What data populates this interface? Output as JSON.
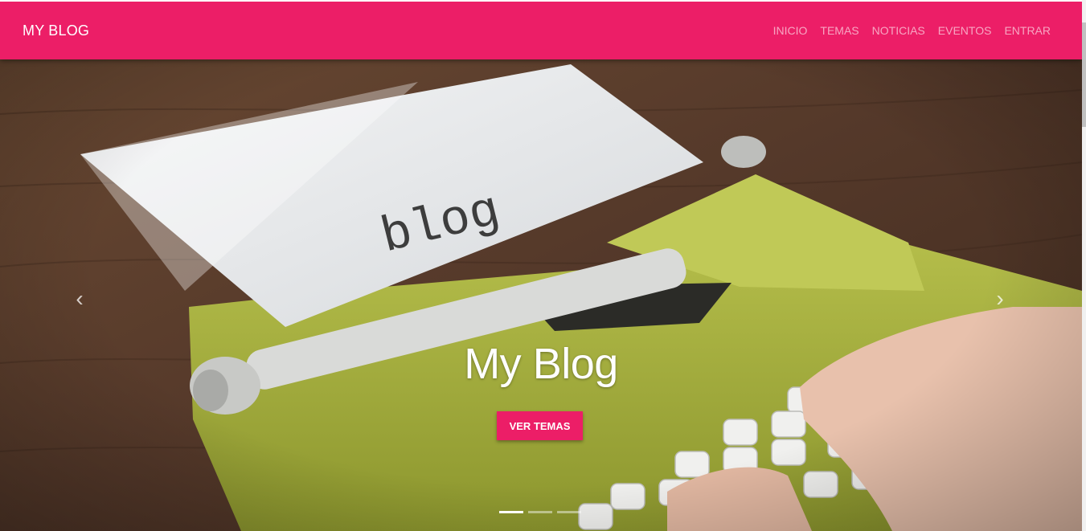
{
  "navbar": {
    "brand": "MY BLOG",
    "items": [
      {
        "label": "INICIO"
      },
      {
        "label": "TEMAS"
      },
      {
        "label": "NOTICIAS"
      },
      {
        "label": "EVENTOS"
      },
      {
        "label": "ENTRAR"
      }
    ],
    "background_color": "#ec1e67"
  },
  "carousel": {
    "image_text": "blog",
    "caption_title": "My Blog",
    "cta_label": "VER TEMAS",
    "prev_icon": "chevron-left-icon",
    "next_icon": "chevron-right-icon",
    "prev_glyph": "‹",
    "next_glyph": "›",
    "slide_count": 3,
    "active_slide": 1
  },
  "colors": {
    "accent": "#ec1e67",
    "typewriter": "#a3ad3c",
    "wood": "#5a3b27"
  }
}
